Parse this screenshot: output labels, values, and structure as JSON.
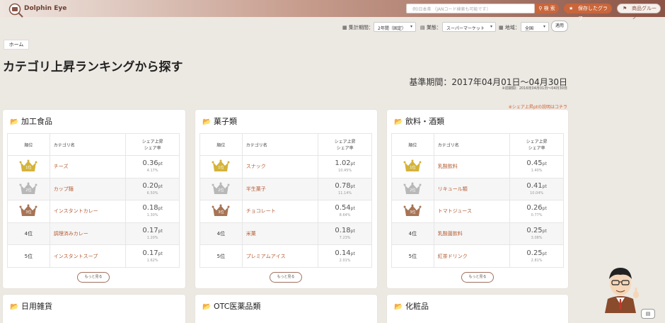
{
  "header": {
    "logo_text": "Dolphin Eye",
    "search_placeholder": "例)日本茶 （JANコード検索も可能です）",
    "search_button": "検 索",
    "saved_graph": "保存したグラフ",
    "product_group": "商品グループ",
    "colors": {
      "accent": "#c9663b",
      "brand_dark": "#8a5446"
    }
  },
  "filters": {
    "period_label": "集計期間：",
    "period_value": "2年間（固定）",
    "industry_label": "業態：",
    "industry_value": "スーパーマーケット",
    "region_label": "地域：",
    "region_value": "全国",
    "apply": "適用"
  },
  "breadcrumb": "ホーム",
  "page_title": "カテゴリ上昇ランキングから探す",
  "period_text": "基準期間：2017年04月01日～04月30日",
  "prev_period_text": "※前期間：2016年04月01日～04月30日",
  "note_link": "※シェア上昇ptの説明はコチラ",
  "table_headers": {
    "rank": "順位",
    "name": "カテゴリ名",
    "share_top": "シェア上昇",
    "share_bottom": "シェア率"
  },
  "more_label": "もっと見る",
  "cards": [
    {
      "title": "加工食品",
      "rows": [
        {
          "rank": "1位",
          "name": "チーズ",
          "pt": "0.36",
          "unit": "pt",
          "share": "4.17%"
        },
        {
          "rank": "2位",
          "name": "カップ麺",
          "pt": "0.20",
          "unit": "pt",
          "share": "6.50%"
        },
        {
          "rank": "3位",
          "name": "インスタントカレー",
          "pt": "0.18",
          "unit": "pt",
          "share": "1.30%"
        },
        {
          "rank": "4位",
          "name": "調理済みカレー",
          "pt": "0.17",
          "unit": "pt",
          "share": "1.20%"
        },
        {
          "rank": "5位",
          "name": "インスタントスープ",
          "pt": "0.17",
          "unit": "pt",
          "share": "1.62%"
        }
      ]
    },
    {
      "title": "菓子類",
      "rows": [
        {
          "rank": "1位",
          "name": "スナック",
          "pt": "1.02",
          "unit": "pt",
          "share": "10.45%"
        },
        {
          "rank": "2位",
          "name": "半生菓子",
          "pt": "0.78",
          "unit": "pt",
          "share": "11.14%"
        },
        {
          "rank": "3位",
          "name": "チョコレート",
          "pt": "0.54",
          "unit": "pt",
          "share": "8.64%"
        },
        {
          "rank": "4位",
          "name": "米菓",
          "pt": "0.18",
          "unit": "pt",
          "share": "7.23%"
        },
        {
          "rank": "5位",
          "name": "プレミアムアイス",
          "pt": "0.14",
          "unit": "pt",
          "share": "2.01%"
        }
      ]
    },
    {
      "title": "飲料・酒類",
      "rows": [
        {
          "rank": "1位",
          "name": "乳酸飲料",
          "pt": "0.45",
          "unit": "pt",
          "share": "1.40%"
        },
        {
          "rank": "2位",
          "name": "リキュール類",
          "pt": "0.41",
          "unit": "pt",
          "share": "10.04%"
        },
        {
          "rank": "3位",
          "name": "トマトジュース",
          "pt": "0.26",
          "unit": "pt",
          "share": "0.77%"
        },
        {
          "rank": "4位",
          "name": "乳酸菌飲料",
          "pt": "0.25",
          "unit": "pt",
          "share": "3.08%"
        },
        {
          "rank": "5位",
          "name": "紅茶ドリンク",
          "pt": "0.25",
          "unit": "pt",
          "share": "2.81%"
        }
      ]
    }
  ],
  "bottom_cards": [
    "日用雑貨",
    "OTC医薬品類",
    "化粧品"
  ],
  "crown_colors": {
    "gold": "#d4b33a",
    "silver": "#b8b8b8",
    "bronze": "#a77454"
  }
}
